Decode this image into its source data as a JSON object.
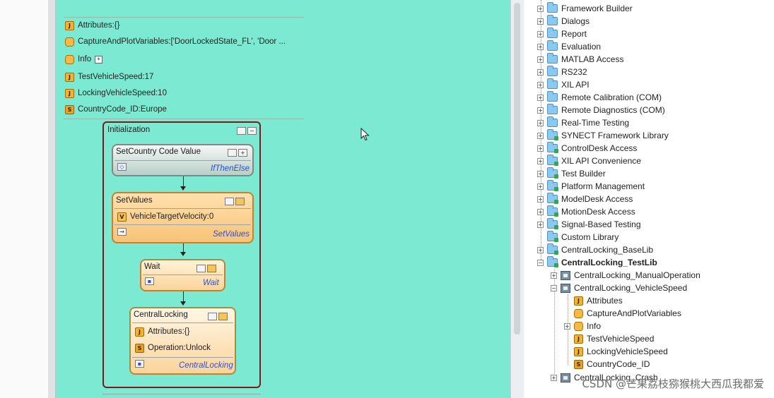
{
  "sequence_header": {
    "items": [
      {
        "icon": "J",
        "text": "Attributes:{}"
      },
      {
        "icon": "cyl",
        "text": "CaptureAndPlotVariables:['DoorLockedState_FL', 'Door ..."
      },
      {
        "icon": "cyl",
        "text": "Info"
      },
      {
        "icon": "J",
        "text": "TestVehicleSpeed:17"
      },
      {
        "icon": "J",
        "text": "LockingVehicleSpeed:10"
      },
      {
        "icon": "S",
        "text": "CountryCode_ID:Europe"
      }
    ]
  },
  "initialization": {
    "title": "Initialization",
    "steps": {
      "set_country": {
        "title": "SetCountry Code Value",
        "link": "IfThenElse"
      },
      "set_values": {
        "title": "SetValues",
        "item": "VehicleTargetVelocity:0",
        "link": "SetValues"
      },
      "wait": {
        "title": "Wait",
        "link": "Wait"
      },
      "central_locking": {
        "title": "CentralLocking",
        "items": [
          "Attributes:{}",
          "Operation:Unlock"
        ],
        "link": "CentralLocking"
      }
    }
  },
  "library_tree": {
    "folders": [
      "Framework Builder",
      "Dialogs",
      "Report",
      "Evaluation",
      "MATLAB Access",
      "RS232",
      "XIL API",
      "Remote Calibration (COM)",
      "Remote Diagnostics (COM)",
      "Real-Time Testing",
      "SYNECT Framework Library",
      "ControlDesk Access",
      "XIL API Convenience",
      "Test Builder",
      "Platform Management",
      "ModelDesk Access",
      "MotionDesk Access",
      "Signal-Based Testing",
      "Custom Library",
      "CentralLocking_BaseLib"
    ],
    "open_library": "CentralLocking_TestLib",
    "sequences": [
      "CentralLocking_ManualOperation",
      "CentralLocking_VehicleSpeed"
    ],
    "children": [
      "Attributes",
      "CaptureAndPlotVariables",
      "Info",
      "TestVehicleSpeed",
      "LockingVehicleSpeed",
      "CountryCode_ID"
    ],
    "last_partial": "CentralLocking_Crash"
  },
  "watermark": "CSDN @芒果荔枝猕猴桃大西瓜我都爱",
  "colors": {
    "canvas": "#7ce9d3",
    "container_border": "#7a1b1b",
    "link": "#2a4fd6",
    "setvalues_fill": "#fbd49a"
  }
}
